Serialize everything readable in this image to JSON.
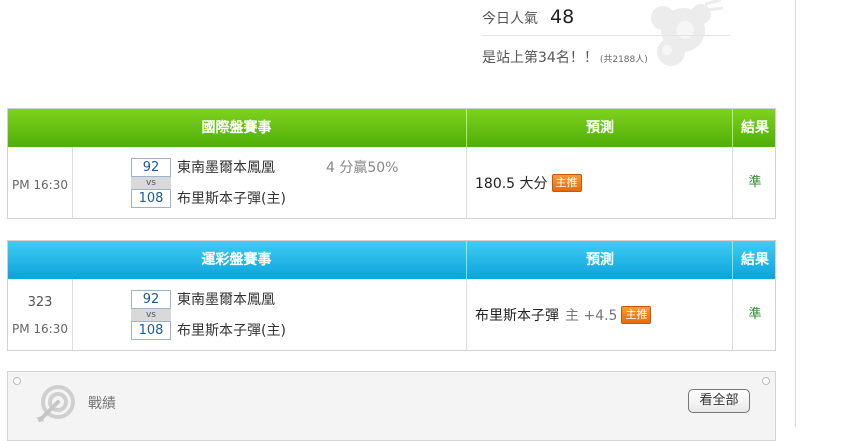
{
  "popularity": {
    "today_label": "今日人氣",
    "today_count": "48",
    "rank_text": "是站上第34名！！",
    "total_text": "(共2188人)"
  },
  "intl_table": {
    "header_event": "國際盤賽事",
    "header_prediction": "預測",
    "header_result": "結果",
    "header_color": "#5cb80f",
    "row": {
      "time": "PM 16:30",
      "away_score": "92",
      "vs": "vs",
      "home_score": "108",
      "away_team": "東南墨爾本鳳凰",
      "home_team": "布里斯本子彈(主)",
      "note": "4 分贏50%",
      "prediction": "180.5 大分",
      "badge": "主推",
      "result": "準"
    }
  },
  "lottery_table": {
    "header_event": "運彩盤賽事",
    "header_prediction": "預測",
    "header_result": "結果",
    "header_color": "#1bb4e8",
    "row": {
      "code": "323",
      "time": "PM 16:30",
      "away_score": "92",
      "vs": "vs",
      "home_score": "108",
      "away_team": "東南墨爾本鳳凰",
      "home_team": "布里斯本子彈(主)",
      "prediction_team": "布里斯本子彈",
      "prediction_line": "主 +4.5",
      "badge": "主推",
      "result": "準"
    }
  },
  "record_panel": {
    "title": "戰績",
    "view_all_label": "看全部",
    "icon": "target-arrow-icon"
  }
}
